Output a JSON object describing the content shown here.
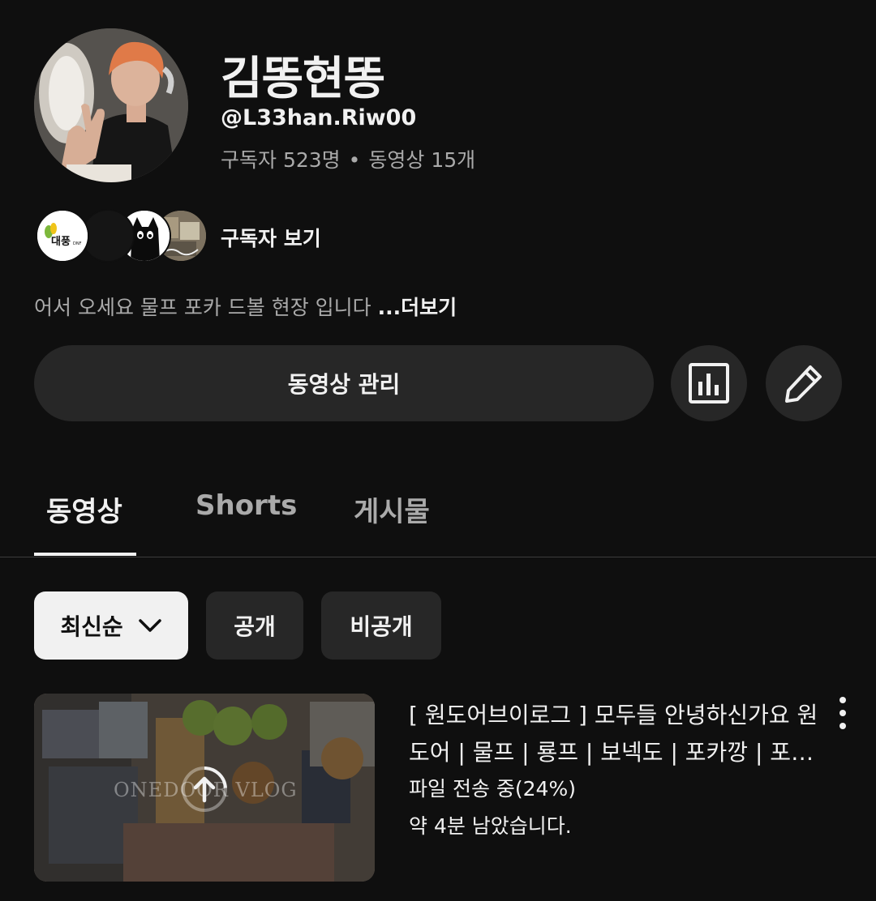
{
  "channel": {
    "name": "김똥현똥",
    "handle": "@L33han.Riw00",
    "subscribers": "구독자 523명",
    "separator": "•",
    "video_count": "동영상 15개",
    "view_subscribers_label": "구독자 보기",
    "subscriber_avatar_logo_text": "대풍",
    "subscriber_avatar_logo_sub": "DNF",
    "description": "어서 오세요 물프 포카 드볼 현장 입니다",
    "more_label": "...더보기"
  },
  "actions": {
    "manage_videos_label": "동영상 관리",
    "analytics_icon": "analytics-icon",
    "edit_icon": "pencil-icon"
  },
  "tabs": [
    {
      "label": "동영상",
      "active": true
    },
    {
      "label": "Shorts",
      "active": false
    },
    {
      "label": "게시물",
      "active": false
    }
  ],
  "filters": {
    "sort_label": "최신순",
    "public_label": "공개",
    "private_label": "비공개"
  },
  "video": {
    "title": "[ 원도어브이로그 ] 모두들 안녕하신가요 원도어 | 물프 | 룡프 | 보넥도 | 포카깡 | 포카 정리",
    "upload_status": "파일 전송 중(24%)",
    "upload_progress": 0.24,
    "time_left": "약 4분 남았습니다.",
    "thumbnail_watermark": "ONEDOOR VLOG"
  },
  "colors": {
    "background": "#0f0f0f",
    "surface": "#272727",
    "text_primary": "#f1f1f1",
    "text_secondary": "#aaaaaa"
  }
}
